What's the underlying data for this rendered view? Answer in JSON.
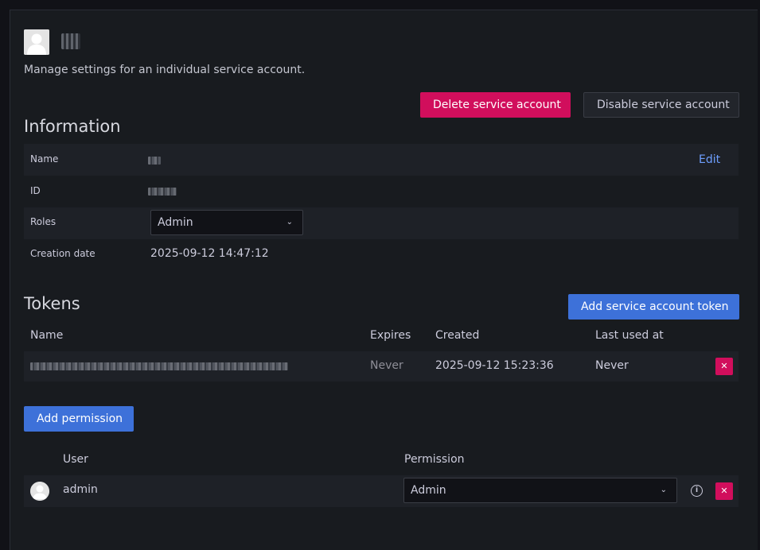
{
  "header": {
    "subtitle": "Manage settings for an individual service account.",
    "delete_label": "Delete service account",
    "disable_label": "Disable service account"
  },
  "information": {
    "title": "Information",
    "name_label": "Name",
    "edit_label": "Edit",
    "id_label": "ID",
    "roles_label": "Roles",
    "role_value": "Admin",
    "creation_label": "Creation date",
    "creation_value": "2025-09-12 14:47:12"
  },
  "tokens": {
    "title": "Tokens",
    "add_label": "Add service account token",
    "columns": [
      "Name",
      "Expires",
      "Created",
      "Last used at"
    ],
    "rows": [
      {
        "expires": "Never",
        "created": "2025-09-12 15:23:36",
        "last_used": "Never"
      }
    ]
  },
  "permissions": {
    "add_label": "Add permission",
    "columns": [
      "User",
      "Permission"
    ],
    "rows": [
      {
        "user": "admin",
        "permission": "Admin"
      }
    ]
  },
  "colors": {
    "danger": "#d10e5c",
    "primary": "#3d71d9",
    "background": "#181b1f"
  }
}
